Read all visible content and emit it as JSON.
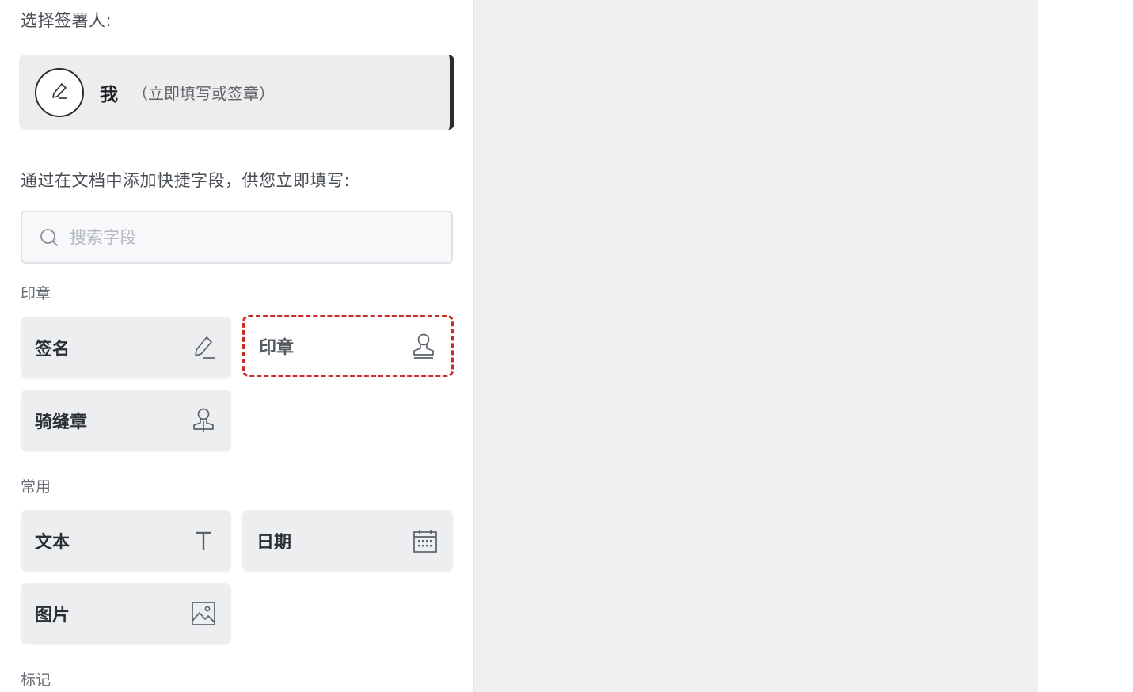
{
  "signer_section": {
    "heading": "选择签署人:",
    "signer": {
      "name": "我",
      "subtitle": "（立即填写或签章）",
      "icon": "pen-icon"
    }
  },
  "fields_section": {
    "heading": "通过在文档中添加快捷字段，供您立即填写:",
    "search": {
      "placeholder": "搜索字段",
      "value": "",
      "icon": "search-icon"
    }
  },
  "groups": {
    "seal": {
      "label": "印章",
      "items": [
        {
          "label": "签名",
          "icon": "pen-icon"
        },
        {
          "label": "印章",
          "icon": "stamp-icon",
          "highlighted": true
        },
        {
          "label": "骑缝章",
          "icon": "stamp-icon"
        }
      ]
    },
    "common": {
      "label": "常用",
      "items": [
        {
          "label": "文本",
          "icon": "text-t-icon"
        },
        {
          "label": "日期",
          "icon": "calendar-icon"
        },
        {
          "label": "图片",
          "icon": "image-icon"
        }
      ]
    },
    "mark": {
      "label": "标记"
    }
  },
  "colors": {
    "highlight_border": "#cc2b2b",
    "tile_bg": "#edeef0",
    "document_bg": "#eeeff0",
    "signer_accent": "#2a2d33"
  }
}
